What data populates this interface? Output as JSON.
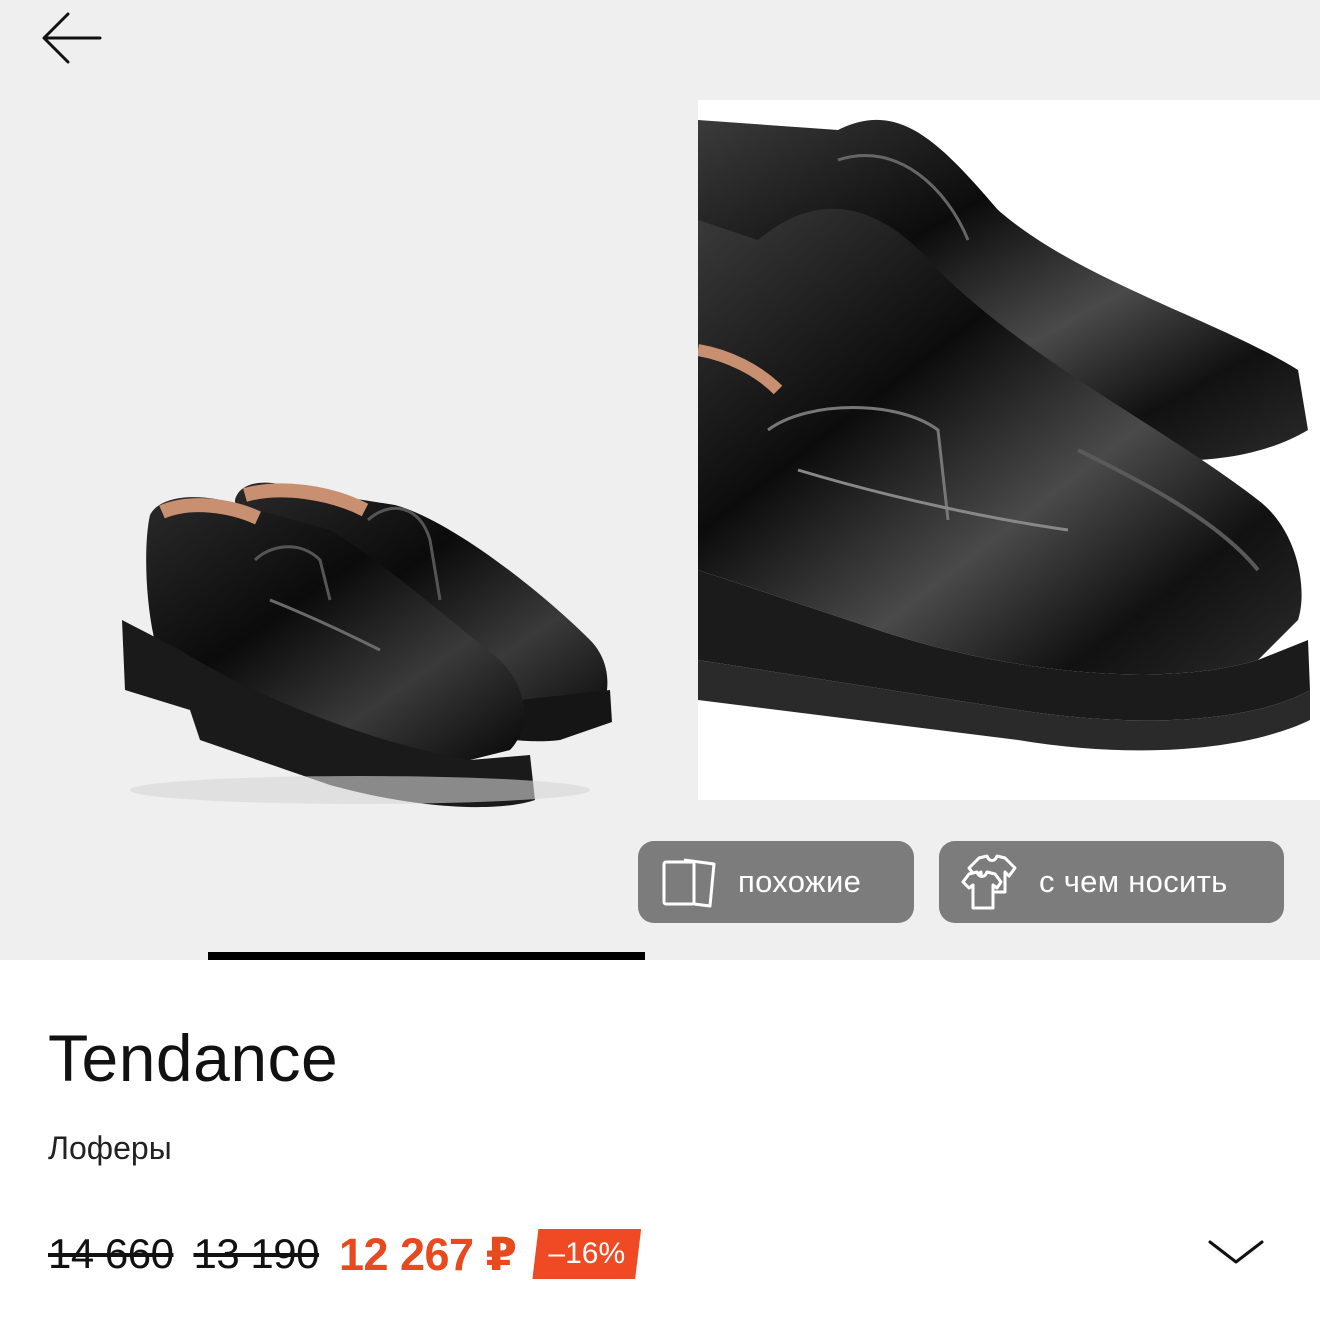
{
  "colors": {
    "gallery_bg": "#efefef",
    "chip_bg": "#7c7c7c",
    "accent_price": "#e84a1f",
    "badge_bg": "#ef4a23",
    "progress": "#000000"
  },
  "gallery": {
    "back_icon": "arrow-left-icon",
    "photos": [
      "loafers-pair-photo",
      "loafers-closeup-photo"
    ],
    "progress": {
      "page": 1,
      "pages": 3
    },
    "chips": {
      "similar_label": "похожие",
      "similar_icon": "cards-icon",
      "outfit_label": "с чем носить",
      "outfit_icon": "outfit-icon"
    }
  },
  "product": {
    "brand": "Tendance",
    "type": "Лоферы",
    "old_price_1": "14 660",
    "old_price_2": "13 190",
    "current_price": "12 267 ₽",
    "discount": "–16%",
    "expand_icon": "chevron-down-icon"
  }
}
